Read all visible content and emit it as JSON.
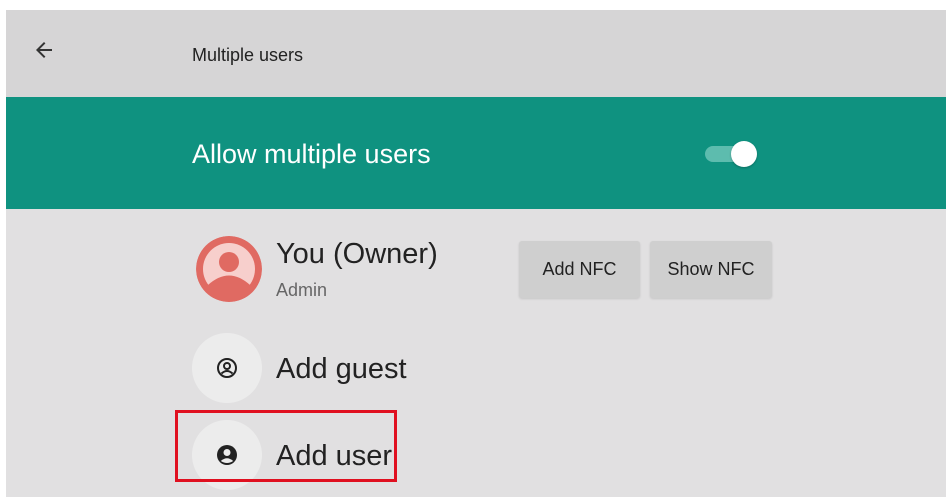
{
  "appbar": {
    "title": "Multiple users",
    "back_icon": "arrow-back-icon"
  },
  "master_switch": {
    "label": "Allow multiple users",
    "enabled": true,
    "color_bg": "#0f9280"
  },
  "owner": {
    "name": "You (Owner)",
    "role": "Admin",
    "avatar_color": "#e06a62",
    "buttons": {
      "add_nfc": "Add NFC",
      "show_nfc": "Show NFC"
    }
  },
  "actions": {
    "add_guest": "Add guest",
    "add_user": "Add user"
  },
  "highlight": {
    "target": "add-user",
    "color": "#e01020"
  }
}
